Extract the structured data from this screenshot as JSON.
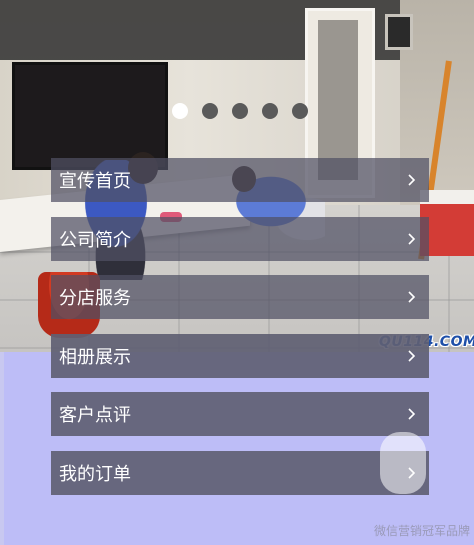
{
  "watermarks": {
    "site": "QU114.COM",
    "brand": "微信营销冠军品牌"
  },
  "pager": {
    "count": 5,
    "active_index": 0
  },
  "menu": {
    "items": [
      {
        "label": "宣传首页",
        "icon": "chevron-right-icon"
      },
      {
        "label": "公司简介",
        "icon": "chevron-right-icon"
      },
      {
        "label": "分店服务",
        "icon": "chevron-right-icon"
      },
      {
        "label": "相册展示",
        "icon": "chevron-right-icon"
      },
      {
        "label": "客户点评",
        "icon": "chevron-right-icon"
      },
      {
        "label": "我的订单",
        "icon": "chevron-right-icon"
      }
    ]
  },
  "colors": {
    "background": "#bdbdf7",
    "menu_item_bg": "#50506a",
    "menu_text": "#ffffff",
    "dot_active": "#ffffff",
    "dot_inactive": "#5a5a5a"
  }
}
